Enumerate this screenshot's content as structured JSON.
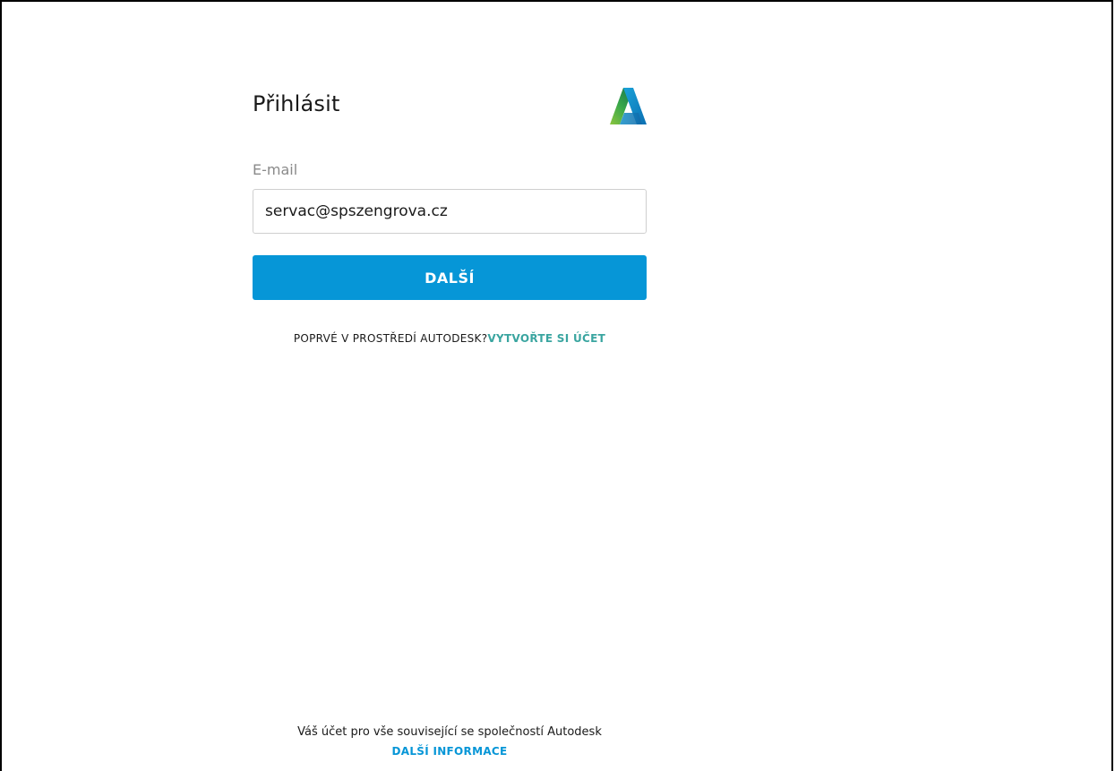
{
  "signin": {
    "title": "Přihlásit",
    "email_label": "E-mail",
    "email_value": "servac@spszengrova.cz",
    "next_button": "DALŠÍ",
    "first_time_text": "POPRVÉ V PROSTŘEDÍ AUTODESK?",
    "create_account_link": "VYTVOŘTE SI ÚČET"
  },
  "footer": {
    "account_text": "Váš účet pro vše související se společností Autodesk",
    "learn_more_link": "DALŠÍ INFORMACE"
  },
  "icons": {
    "logo": "autodesk-logo-icon"
  },
  "colors": {
    "primary_button": "#0696d7",
    "create_account_link": "#3aa5a0",
    "footer_link": "#0696d7",
    "label": "#8a8a8a"
  }
}
